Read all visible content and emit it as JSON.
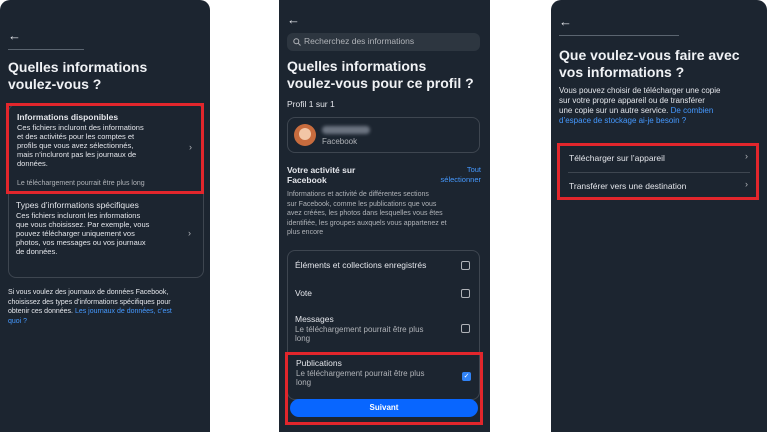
{
  "screen1": {
    "title_line1": "Quelles informations",
    "title_line2": "voulez-vous ?",
    "option1": {
      "title": "Informations disponibles",
      "desc_lines": [
        "Ces fichiers incluront des informations",
        "et des activités pour les comptes et",
        "profils que vous avez sélectionnés,",
        "mais n’incluront pas les journaux de",
        "données."
      ],
      "note": "Le téléchargement pourrait être plus long"
    },
    "option2": {
      "title": "Types d’informations spécifiques",
      "desc_lines": [
        "Ces fichiers incluront les informations",
        "que vous choisissez. Par exemple, vous",
        "pouvez télécharger uniquement vos",
        "photos, vos messages ou vos journaux",
        "de données."
      ]
    },
    "footer_lines": [
      "Si vous voulez des journaux de données Facebook,",
      "choisissez des types d’informations spécifiques pour"
    ],
    "footer_line3": "obtenir ces données. ",
    "footer_link1": "Les journaux de données, c’est",
    "footer_link2": "quoi ?"
  },
  "screen2": {
    "search_placeholder": "Recherchez des informations",
    "title_line1": "Quelles informations",
    "title_line2": "voulez-vous pour ce profil ?",
    "profile_count": "Profil 1 sur 1",
    "profile_platform": "Facebook",
    "activity_title_line1": "Votre activité sur",
    "activity_title_line2": "Facebook",
    "select_all_line1": "Tout",
    "select_all_line2": "sélectionner",
    "activity_desc_lines": [
      "Informations et activité de différentes sections",
      "sur Facebook, comme les publications que vous",
      "avez créées, les photos dans lesquelles vous êtes",
      "identifiée, les groupes auxquels vous appartenez et",
      "plus encore"
    ],
    "items": [
      {
        "label": "Éléments et collections enregistrés",
        "checked": false
      },
      {
        "label": "Vote",
        "checked": false
      },
      {
        "label": "Messages",
        "sub1": "Le téléchargement pourrait être plus",
        "sub2": "long",
        "checked": false
      },
      {
        "label": "Publications",
        "sub1": "Le téléchargement pourrait être plus",
        "sub2": "long",
        "checked": true
      }
    ],
    "next_button": "Suivant"
  },
  "screen3": {
    "title_line1": "Que voulez-vous faire avec",
    "title_line2": "vos informations ?",
    "desc_lines": [
      "Vous pouvez choisir de télécharger une copie",
      "sur votre propre appareil ou de transférer"
    ],
    "desc_line3": "une copie sur un autre service. ",
    "desc_link1": "De combien",
    "desc_link2": "d’espace de stockage ai-je besoin ?",
    "option_download": "Télécharger sur l’appareil",
    "option_transfer": "Transférer vers une destination"
  },
  "icons": {
    "back": "back-arrow-icon",
    "chevron": "chevron-right-icon",
    "search": "search-icon",
    "check": "checkmark-icon"
  },
  "colors": {
    "background": "#1c2530",
    "highlight": "#e2262c",
    "link": "#4599ff",
    "primary_button": "#0866ff"
  }
}
